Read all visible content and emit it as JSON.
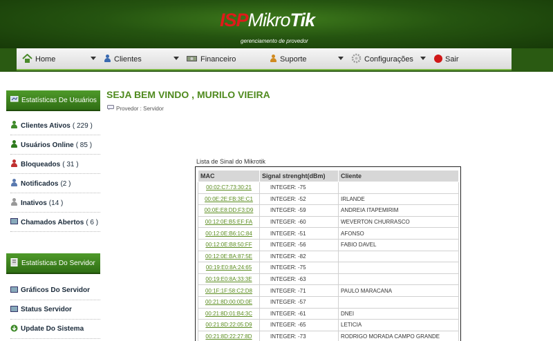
{
  "header": {
    "logo": {
      "isp": "ISP",
      "mikro": "Mikro",
      "tik": "Tik"
    },
    "subtitle": "gerenciamento de provedor"
  },
  "nav": {
    "items": [
      {
        "label": "Home",
        "icon": "home-icon"
      },
      {
        "label": "Clientes",
        "icon": "users-icon"
      },
      {
        "label": "Financeiro",
        "icon": "money-icon"
      },
      {
        "label": "Suporte",
        "icon": "support-icon"
      },
      {
        "label": "Configurações",
        "icon": "gear-icon"
      },
      {
        "label": "Sair",
        "icon": "exit-icon"
      }
    ]
  },
  "sidebar": {
    "users_heading": "Estatísticas De Usuários",
    "users_items": [
      {
        "label": "Clientes Ativos",
        "count": "( 229 )"
      },
      {
        "label": "Usuários Online",
        "count": "( 85 )"
      },
      {
        "label": "Bloqueados",
        "count": "( 31 )"
      },
      {
        "label": "Notificados",
        "count": "(2 )"
      },
      {
        "label": "Inativos",
        "count": "(14 )"
      },
      {
        "label": "Chamados Abertos",
        "count": "( 6 )"
      }
    ],
    "server_heading": "Estatísticas Do Servidor",
    "server_items": [
      {
        "label": "Gráficos Do Servidor"
      },
      {
        "label": "Status Servidor"
      },
      {
        "label": "Update Do Sistema"
      }
    ]
  },
  "main": {
    "welcome": "SEJA BEM VINDO , MURILO VIEIRA",
    "breadcrumb": "Provedor : Servidor"
  },
  "signal_table": {
    "title": "Lista de Sinal do Mikrotik",
    "headers": [
      "MAC",
      "Signal strenght(dBm)",
      "Cliente"
    ],
    "rows": [
      {
        "mac": "00:02:C7:73:30:21",
        "signal": "INTEGER: -75",
        "client": ""
      },
      {
        "mac": "00:0E:2E:FB:3E:C1",
        "signal": "INTEGER: -52",
        "client": "IRLANDE"
      },
      {
        "mac": "00:0E:E8:DD:F3:D9",
        "signal": "INTEGER: -59",
        "client": "ANDREIA ITAPEMIRIM"
      },
      {
        "mac": "00:12:0E:B5:EF:FA",
        "signal": "INTEGER: -60",
        "client": "WEVERTON CHURRASCO"
      },
      {
        "mac": "00:12:0E:B6:1C:84",
        "signal": "INTEGER: -51",
        "client": "AFONSO"
      },
      {
        "mac": "00:12:0E:B8:50:FF",
        "signal": "INTEGER: -56",
        "client": "FABIO DAVEL"
      },
      {
        "mac": "00:12:0E:BA:87:5E",
        "signal": "INTEGER: -82",
        "client": ""
      },
      {
        "mac": "00:19:E0:8A:24:65",
        "signal": "INTEGER: -75",
        "client": ""
      },
      {
        "mac": "00:19:E0:8A:33:3E",
        "signal": "INTEGER: -63",
        "client": ""
      },
      {
        "mac": "00:1F:1F:58:C2:D8",
        "signal": "INTEGER: -71",
        "client": "PAULO MARACANA"
      },
      {
        "mac": "00:21:8D:00:0D:0E",
        "signal": "INTEGER: -57",
        "client": ""
      },
      {
        "mac": "00:21:8D:01:B4:3C",
        "signal": "INTEGER: -61",
        "client": "DNEI"
      },
      {
        "mac": "00:21:8D:22:05:D9",
        "signal": "INTEGER: -65",
        "client": "LETICIA"
      },
      {
        "mac": "00:21:8D:22:27:8D",
        "signal": "INTEGER: -73",
        "client": "RODRIGO MORADA CAMPO GRANDE"
      }
    ]
  },
  "colors": {
    "header_green": "#255410",
    "accent_green": "#4f8a1e",
    "logo_red": "#e01a1a",
    "link_green": "#5a8c1e"
  }
}
